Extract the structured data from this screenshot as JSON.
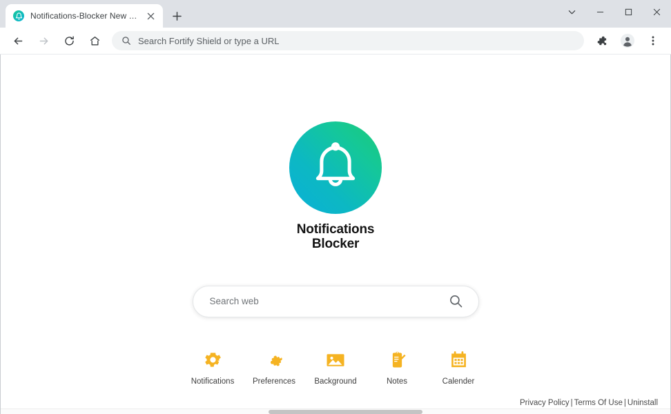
{
  "window": {
    "controls": [
      {
        "name": "tab-search",
        "icon": "chevron-down-icon",
        "label": "Search tabs"
      },
      {
        "name": "minimize",
        "icon": "minimize-icon",
        "label": "Minimize"
      },
      {
        "name": "maximize",
        "icon": "maximize-icon",
        "label": "Maximize"
      },
      {
        "name": "close",
        "icon": "close-icon",
        "label": "Close"
      }
    ]
  },
  "tabstrip": {
    "tab": {
      "title": "Notifications-Blocker New Tab",
      "favicon": "bell-logo-icon",
      "close_label": "Close tab"
    },
    "new_tab_label": "New tab"
  },
  "toolbar": {
    "back_label": "Back",
    "forward_label": "Forward",
    "reload_label": "Reload",
    "home_label": "Home",
    "omnibox": {
      "icon": "search-icon",
      "placeholder": "Search Fortify Shield or type a URL",
      "value": ""
    },
    "extensions_label": "Extensions",
    "profile_label": "Profile",
    "menu_label": "Customize and control"
  },
  "page": {
    "brand": {
      "line1": "Notifications",
      "line2": "Blocker",
      "logo_icon": "bell-icon",
      "gradient_from": "#0ab0d8",
      "gradient_to": "#1ccb77"
    },
    "search": {
      "placeholder": "Search web",
      "value": "",
      "icon": "search-icon"
    },
    "shortcuts": [
      {
        "label": "Notifications",
        "icon": "gear-icon"
      },
      {
        "label": "Preferences",
        "icon": "puzzle-icon"
      },
      {
        "label": "Background",
        "icon": "image-icon"
      },
      {
        "label": "Notes",
        "icon": "notepad-pencil-icon"
      },
      {
        "label": "Calender",
        "icon": "calendar-icon"
      }
    ],
    "shortcut_color": "#f5b322",
    "footer": {
      "privacy": "Privacy Policy",
      "sep1": "|",
      "terms": "Terms Of Use",
      "sep2": "|",
      "uninstall": "Uninstall"
    }
  }
}
